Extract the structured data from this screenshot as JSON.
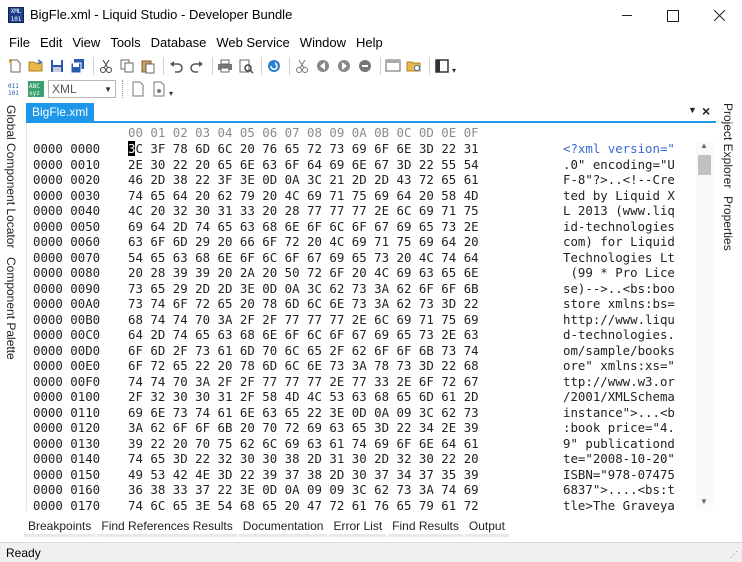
{
  "window": {
    "title": "BigFle.xml - Liquid Studio - Developer Bundle",
    "icon_text": "XML\n101"
  },
  "menu": [
    "File",
    "Edit",
    "View",
    "Tools",
    "Database",
    "Web Service",
    "Window",
    "Help"
  ],
  "toolbar": {
    "language_value": "XML"
  },
  "left_panels": [
    "Global Component Locator",
    "Component Palette"
  ],
  "right_panels": [
    "Project Explorer",
    "Properties"
  ],
  "document_tab": "BigFle.xml",
  "hex": {
    "column_header": "00 01 02 03 04 05 06 07 08 09 0A 0B 0C 0D 0E 0F",
    "cursor_first_char": "3",
    "rows": [
      {
        "addr": "0000 0000",
        "bytes": "3C 3F 78 6D 6C 20 76 65 72 73 69 6F 6E 3D 22 31",
        "ascii": "<?xml version=\""
      },
      {
        "addr": "0000 0010",
        "bytes": "2E 30 22 20 65 6E 63 6F 64 69 6E 67 3D 22 55 54",
        "ascii": ".0\" encoding=\"U"
      },
      {
        "addr": "0000 0020",
        "bytes": "46 2D 38 22 3F 3E 0D 0A 3C 21 2D 2D 43 72 65 61",
        "ascii": "F-8\"?>..<!--Cre"
      },
      {
        "addr": "0000 0030",
        "bytes": "74 65 64 20 62 79 20 4C 69 71 75 69 64 20 58 4D",
        "ascii": "ted by Liquid X"
      },
      {
        "addr": "0000 0040",
        "bytes": "4C 20 32 30 31 33 20 28 77 77 77 2E 6C 69 71 75",
        "ascii": "L 2013 (www.liq"
      },
      {
        "addr": "0000 0050",
        "bytes": "69 64 2D 74 65 63 68 6E 6F 6C 6F 67 69 65 73 2E",
        "ascii": "id-technologies"
      },
      {
        "addr": "0000 0060",
        "bytes": "63 6F 6D 29 20 66 6F 72 20 4C 69 71 75 69 64 20",
        "ascii": "com) for Liquid"
      },
      {
        "addr": "0000 0070",
        "bytes": "54 65 63 68 6E 6F 6C 6F 67 69 65 73 20 4C 74 64",
        "ascii": "Technologies Lt"
      },
      {
        "addr": "0000 0080",
        "bytes": "20 28 39 39 20 2A 20 50 72 6F 20 4C 69 63 65 6E",
        "ascii": " (99 * Pro Lice"
      },
      {
        "addr": "0000 0090",
        "bytes": "73 65 29 2D 2D 3E 0D 0A 3C 62 73 3A 62 6F 6F 6B",
        "ascii": "se)-->..<bs:boo"
      },
      {
        "addr": "0000 00A0",
        "bytes": "73 74 6F 72 65 20 78 6D 6C 6E 73 3A 62 73 3D 22",
        "ascii": "store xmlns:bs="
      },
      {
        "addr": "0000 00B0",
        "bytes": "68 74 74 70 3A 2F 2F 77 77 77 2E 6C 69 71 75 69",
        "ascii": "http://www.liqu"
      },
      {
        "addr": "0000 00C0",
        "bytes": "64 2D 74 65 63 68 6E 6F 6C 6F 67 69 65 73 2E 63",
        "ascii": "d-technologies."
      },
      {
        "addr": "0000 00D0",
        "bytes": "6F 6D 2F 73 61 6D 70 6C 65 2F 62 6F 6F 6B 73 74",
        "ascii": "om/sample/books"
      },
      {
        "addr": "0000 00E0",
        "bytes": "6F 72 65 22 20 78 6D 6C 6E 73 3A 78 73 3D 22 68",
        "ascii": "ore\" xmlns:xs=\""
      },
      {
        "addr": "0000 00F0",
        "bytes": "74 74 70 3A 2F 2F 77 77 77 2E 77 33 2E 6F 72 67",
        "ascii": "ttp://www.w3.or"
      },
      {
        "addr": "0000 0100",
        "bytes": "2F 32 30 30 31 2F 58 4D 4C 53 63 68 65 6D 61 2D",
        "ascii": "/2001/XMLSchema"
      },
      {
        "addr": "0000 0110",
        "bytes": "69 6E 73 74 61 6E 63 65 22 3E 0D 0A 09 3C 62 73",
        "ascii": "instance\">...<b"
      },
      {
        "addr": "0000 0120",
        "bytes": "3A 62 6F 6F 6B 20 70 72 69 63 65 3D 22 34 2E 39",
        "ascii": ":book price=\"4."
      },
      {
        "addr": "0000 0130",
        "bytes": "39 22 20 70 75 62 6C 69 63 61 74 69 6F 6E 64 61",
        "ascii": "9\" publicationd"
      },
      {
        "addr": "0000 0140",
        "bytes": "74 65 3D 22 32 30 30 38 2D 31 30 2D 32 30 22 20",
        "ascii": "te=\"2008-10-20\""
      },
      {
        "addr": "0000 0150",
        "bytes": "49 53 42 4E 3D 22 39 37 38 2D 30 37 34 37 35 39",
        "ascii": "ISBN=\"978-07475"
      },
      {
        "addr": "0000 0160",
        "bytes": "36 38 33 37 22 3E 0D 0A 09 09 3C 62 73 3A 74 69",
        "ascii": "6837\">....<bs:t"
      },
      {
        "addr": "0000 0170",
        "bytes": "74 6C 65 3E 54 68 65 20 47 72 61 76 65 79 61 72",
        "ascii": "tle>The Graveya"
      }
    ]
  },
  "bottom_tabs": [
    "Breakpoints",
    "Find References Results",
    "Documentation",
    "Error List",
    "Find Results",
    "Output"
  ],
  "status": "Ready"
}
